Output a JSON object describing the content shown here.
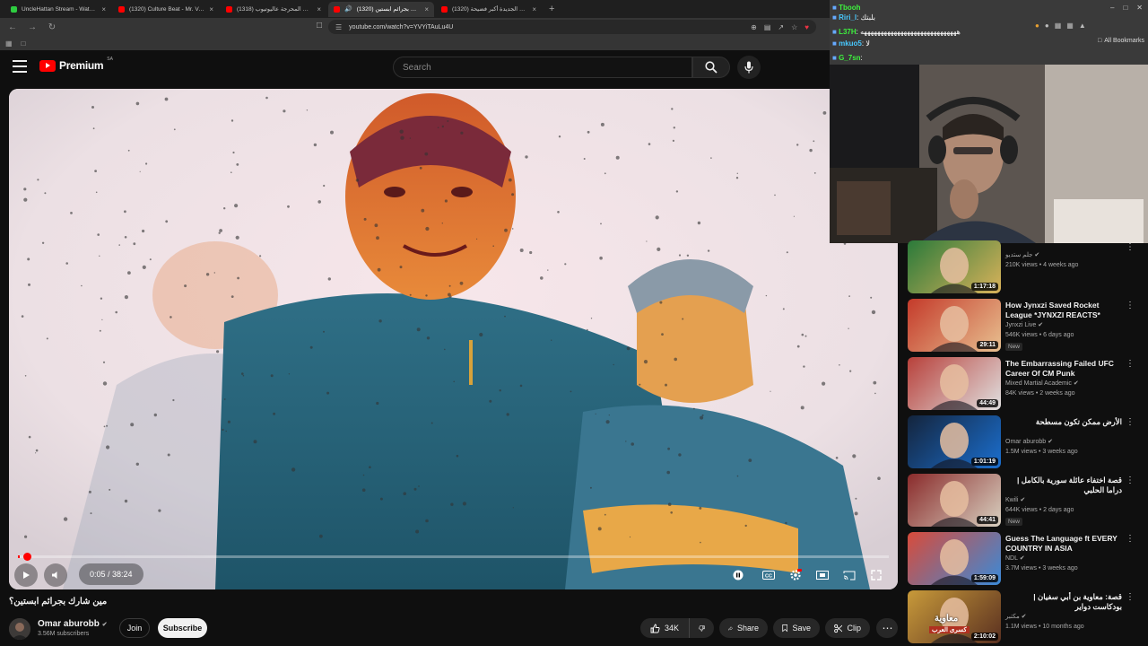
{
  "browser": {
    "tabs": [
      {
        "label": "UncleHattan Stream - Watch Live",
        "color": "#2ecc40"
      },
      {
        "label": "(1320) Culture Beat - Mr. Vain (Offici...",
        "color": "#ff0000"
      },
      {
        "label": "(1318) أكثر اللحظات المحرجة عاليوتيوب...",
        "color": "#ff0000"
      },
      {
        "label": "(1320) مين شارك بجرائم ابستين...",
        "color": "#ff0000",
        "active": true
      },
      {
        "label": "(1320) ملفات ابستين الجديدة أكبر فضيحة...",
        "color": "#ff0000"
      }
    ],
    "url": "youtube.com/watch?v=YVYiTAuLu4U",
    "all_bookmarks": "All Bookmarks"
  },
  "youtube": {
    "logo_word": "Premium",
    "country": "SA",
    "search_placeholder": "Search"
  },
  "player": {
    "time": "0:05 / 38:24",
    "progress": 0.0022
  },
  "video": {
    "title": "مين شارك بجرائم ابستين؟",
    "channel": "Omar aburobb",
    "subscribers": "3.56M subscribers",
    "join_label": "Join",
    "subscribe_label": "Subscribe",
    "likes": "34K",
    "share_label": "Share",
    "save_label": "Save",
    "clip_label": "Clip"
  },
  "chat": [
    {
      "user": "Tbooh",
      "text": ""
    },
    {
      "user": "Riri_l",
      "text": ": بلبتك"
    },
    {
      "user": "L37H",
      "text": ": هههههههههههههههههههههههههههههه"
    },
    {
      "user": "mkuo5",
      "text": ": لا"
    },
    {
      "user": "G_7sn",
      "text": ":"
    }
  ],
  "recommendations": [
    {
      "title": "",
      "channel": "جلم ستديو",
      "meta": "210K views • 4 weeks ago",
      "duration": "1:17:18",
      "badge": "",
      "rtl": true,
      "thumb": [
        "#2a7a3a",
        "#d9b25a"
      ]
    },
    {
      "title": "How Jynxzi Saved Rocket League *JYNXZI REACTS*",
      "channel": "Jynxzi Live",
      "meta": "546K views • 6 days ago",
      "duration": "29:11",
      "badge": "New",
      "rtl": false,
      "thumb": [
        "#c43a2a",
        "#e8c090"
      ]
    },
    {
      "title": "The Embarrassing Failed UFC Career Of CM Punk",
      "channel": "Mixed Martial Academic",
      "meta": "84K views • 2 weeks ago",
      "duration": "44:49",
      "badge": "",
      "rtl": false,
      "thumb": [
        "#b8403a",
        "#e0e0e0"
      ]
    },
    {
      "title": "الأرض ممكن تكون مسطحة",
      "channel": "Omar aburobb",
      "meta": "1.5M views • 3 weeks ago",
      "duration": "1:01:19",
      "badge": "",
      "rtl": true,
      "thumb": [
        "#14243c",
        "#1b6fcf"
      ]
    },
    {
      "title": "قصة اختفاء عائلة سورية بالكامل | دراما الحلبي",
      "channel": "Kwili",
      "meta": "644K views • 2 days ago",
      "duration": "44:41",
      "badge": "New",
      "rtl": true,
      "thumb": [
        "#8a2b2b",
        "#d8d0c0"
      ]
    },
    {
      "title": "Guess The Language ft EVERY COUNTRY IN ASIA",
      "channel": "NDL",
      "meta": "3.7M views • 3 weeks ago",
      "duration": "1:59:09",
      "badge": "",
      "rtl": false,
      "thumb": [
        "#d84b3a",
        "#3a8ad8"
      ]
    },
    {
      "title": "قصة: معاوية بن أبي سفيان | بودكاست دواير",
      "channel": "مكتبر",
      "meta": "1.1M views • 10 months ago",
      "duration": "2:10:02",
      "badge": "",
      "rtl": true,
      "thumb": [
        "#c89a3a",
        "#5a3020"
      ]
    }
  ],
  "thumb_texts": {
    "rec6": "معاوية",
    "rec6_sub": "كسرى العرب"
  },
  "colors": {
    "accent": "#ff0000",
    "chat_user": "#3ef03e"
  }
}
